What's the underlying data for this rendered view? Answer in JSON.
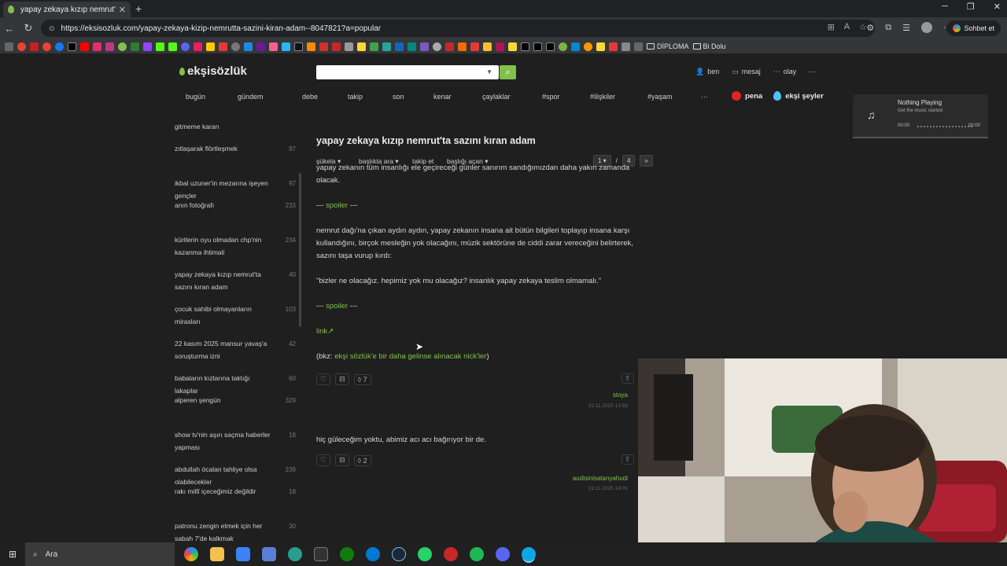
{
  "browser": {
    "tab_title": "yapay zekaya kızıp nemrut'ta sazı",
    "url": "https://eksisozluk.com/yapay-zekaya-kizip-nemrutta-sazini-kiran-adam--8047821?a=popular",
    "copilot_label": "Sohbet et",
    "bookmarks": [
      {
        "label": "DİPLOMA"
      },
      {
        "label": "Bi Dolu"
      }
    ]
  },
  "site": {
    "logo": "ekşisözlük",
    "search_placeholder": "",
    "user_menu": [
      "ben",
      "mesaj",
      "olay",
      "···"
    ],
    "nav": [
      "bugün",
      "gündem",
      "debe",
      "takip",
      "son",
      "kenar",
      "çaylaklar",
      "#spor",
      "#ilişkiler",
      "#yaşam",
      "···"
    ],
    "special": [
      "pena",
      "ekşi şeyler"
    ]
  },
  "player": {
    "title": "Nothing Playing",
    "subtitle": "Get the music started",
    "time_start": "00:00",
    "time_end": "00:00"
  },
  "sidebar": [
    {
      "title": "gitmeme kararı",
      "count": ""
    },
    {
      "title": "zıtlaşarak flörtleşmek",
      "count": "97"
    },
    {
      "title": "ikbal uzuner'in mezarına işeyen gençler",
      "count": "97"
    },
    {
      "title": "anın fotoğrafı",
      "count": "233"
    },
    {
      "title": "kürtlerin oyu olmadan chp'nin kazanma ihtimali",
      "count": "234"
    },
    {
      "title": "yapay zekaya kızıp nemrut'ta sazını kıran adam",
      "count": "40"
    },
    {
      "title": "çocuk sahibi olmayanların mirasları",
      "count": "103"
    },
    {
      "title": "22 kasım 2025 mansur yavaş'a soruşturma izni",
      "count": "42"
    },
    {
      "title": "babaların kızlarına taktığı lakaplar",
      "count": "60"
    },
    {
      "title": "alperen şengün",
      "count": "329"
    },
    {
      "title": "show tv'nin aşırı saçma haberler yapması",
      "count": "18"
    },
    {
      "title": "abdullah öcalan tahliye olsa olabilecekler",
      "count": "239"
    },
    {
      "title": "rakı millî içeceğimiz değildir",
      "count": "18"
    },
    {
      "title": "patronu zengin etmek için her sabah 7'de kalkmak",
      "count": "30"
    }
  ],
  "topic": {
    "title": "yapay zekaya kızıp nemrut'ta sazını kıran adam",
    "tools": [
      "şükela",
      "başlıkta ara",
      "takip et",
      "başlığı açan"
    ],
    "page_current": "1",
    "page_sep": "/",
    "page_total": "4",
    "page_next": "»"
  },
  "entries": [
    {
      "p1": "yapay zekanın tüm insanlığı ele geçireceği günler sanırım sandığımızdan daha yakın zamanda olacak.",
      "spoiler1_pre": "--- ",
      "spoiler1_link": "spoiler",
      "spoiler1_post": " ---",
      "p2": "nemrut dağı'na çıkan aydın aydın, yapay zekanın insana ait bütün bilgileri toplayıp insana karşı kullandığını, birçok mesleğin yok olacağını, müzik sektörüne de ciddi zarar vereceğini belirterek, sazını taşa vurup kırdı:",
      "p3": "\"bizler ne olacağız. hepimiz yok mu olacağız? insanlık yapay zekaya teslim olmamalı.\"",
      "spoiler2_pre": "--- ",
      "spoiler2_link": "spoiler",
      "spoiler2_post": " ---",
      "link_text": "link",
      "bkz_pre": "(bkz: ",
      "bkz_link": "ekşi sözlük'e bir daha gelinse alınacak nick'ler",
      "bkz_post": ")",
      "votes": "7",
      "author": "stoya",
      "date": "22.11.2025 13:58"
    },
    {
      "p1": "hiç güleceğim yoktu, abimiz acı acı bağırıyor bir de.",
      "votes": "2",
      "author": "audisinisatanyahudi",
      "date": "22.11.2025 14:01"
    }
  ],
  "taskbar": {
    "search_label": "Ara"
  }
}
